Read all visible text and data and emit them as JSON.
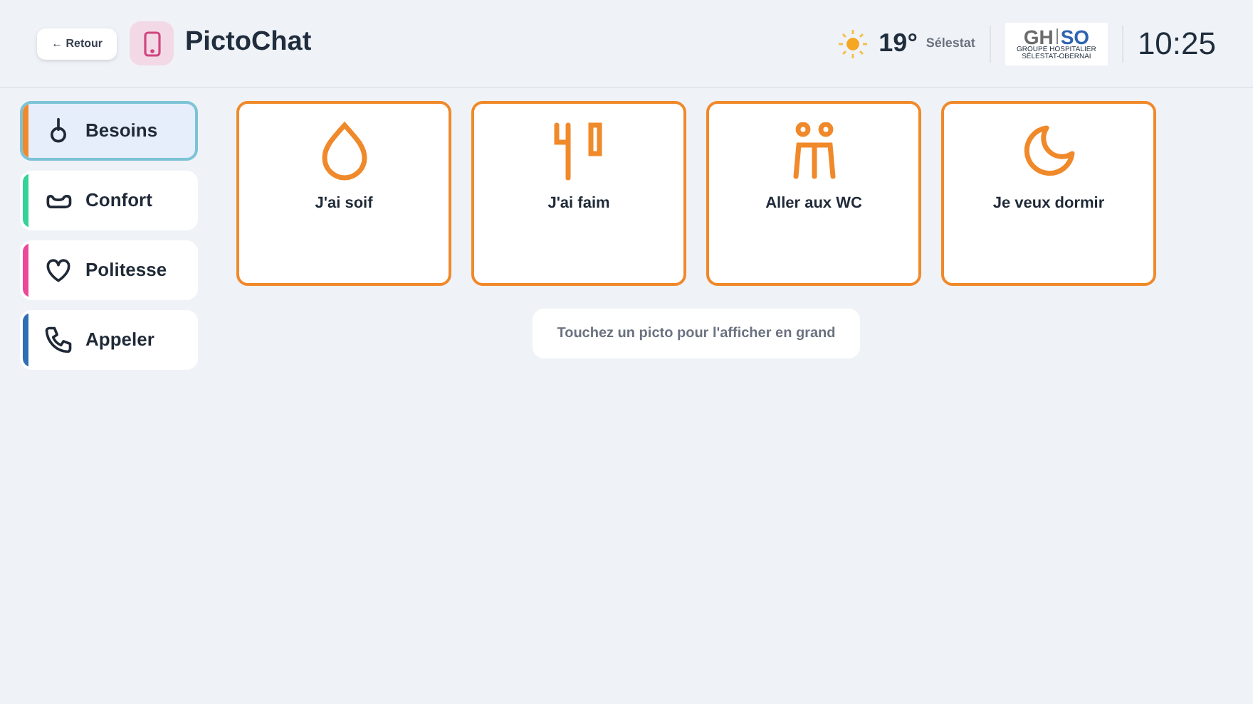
{
  "header": {
    "back_button": "← Retour",
    "app_title": "PictoChat",
    "weather": {
      "temperature": "19°",
      "city": "Sélestat"
    },
    "logo": {
      "line_1a": "GH",
      "line_1b": "SO",
      "line_2": "GROUPE HOSPITALIER",
      "line_3": "SÉLESTAT-OBERNAI"
    },
    "clock": "10:25"
  },
  "categories": [
    {
      "label": "Besoins",
      "color": "#f0892a",
      "selected": true
    },
    {
      "label": "Confort",
      "color": "#34d399",
      "selected": false
    },
    {
      "label": "Politesse",
      "color": "#ec4899",
      "selected": false
    },
    {
      "label": "Appeler",
      "color": "#2f6db5",
      "selected": false
    }
  ],
  "pictos": [
    {
      "label": "J'ai soif"
    },
    {
      "label": "J'ai faim"
    },
    {
      "label": "Aller aux WC"
    },
    {
      "label": "Je veux dormir"
    }
  ],
  "hint": "Touchez un picto pour l'afficher en grand"
}
